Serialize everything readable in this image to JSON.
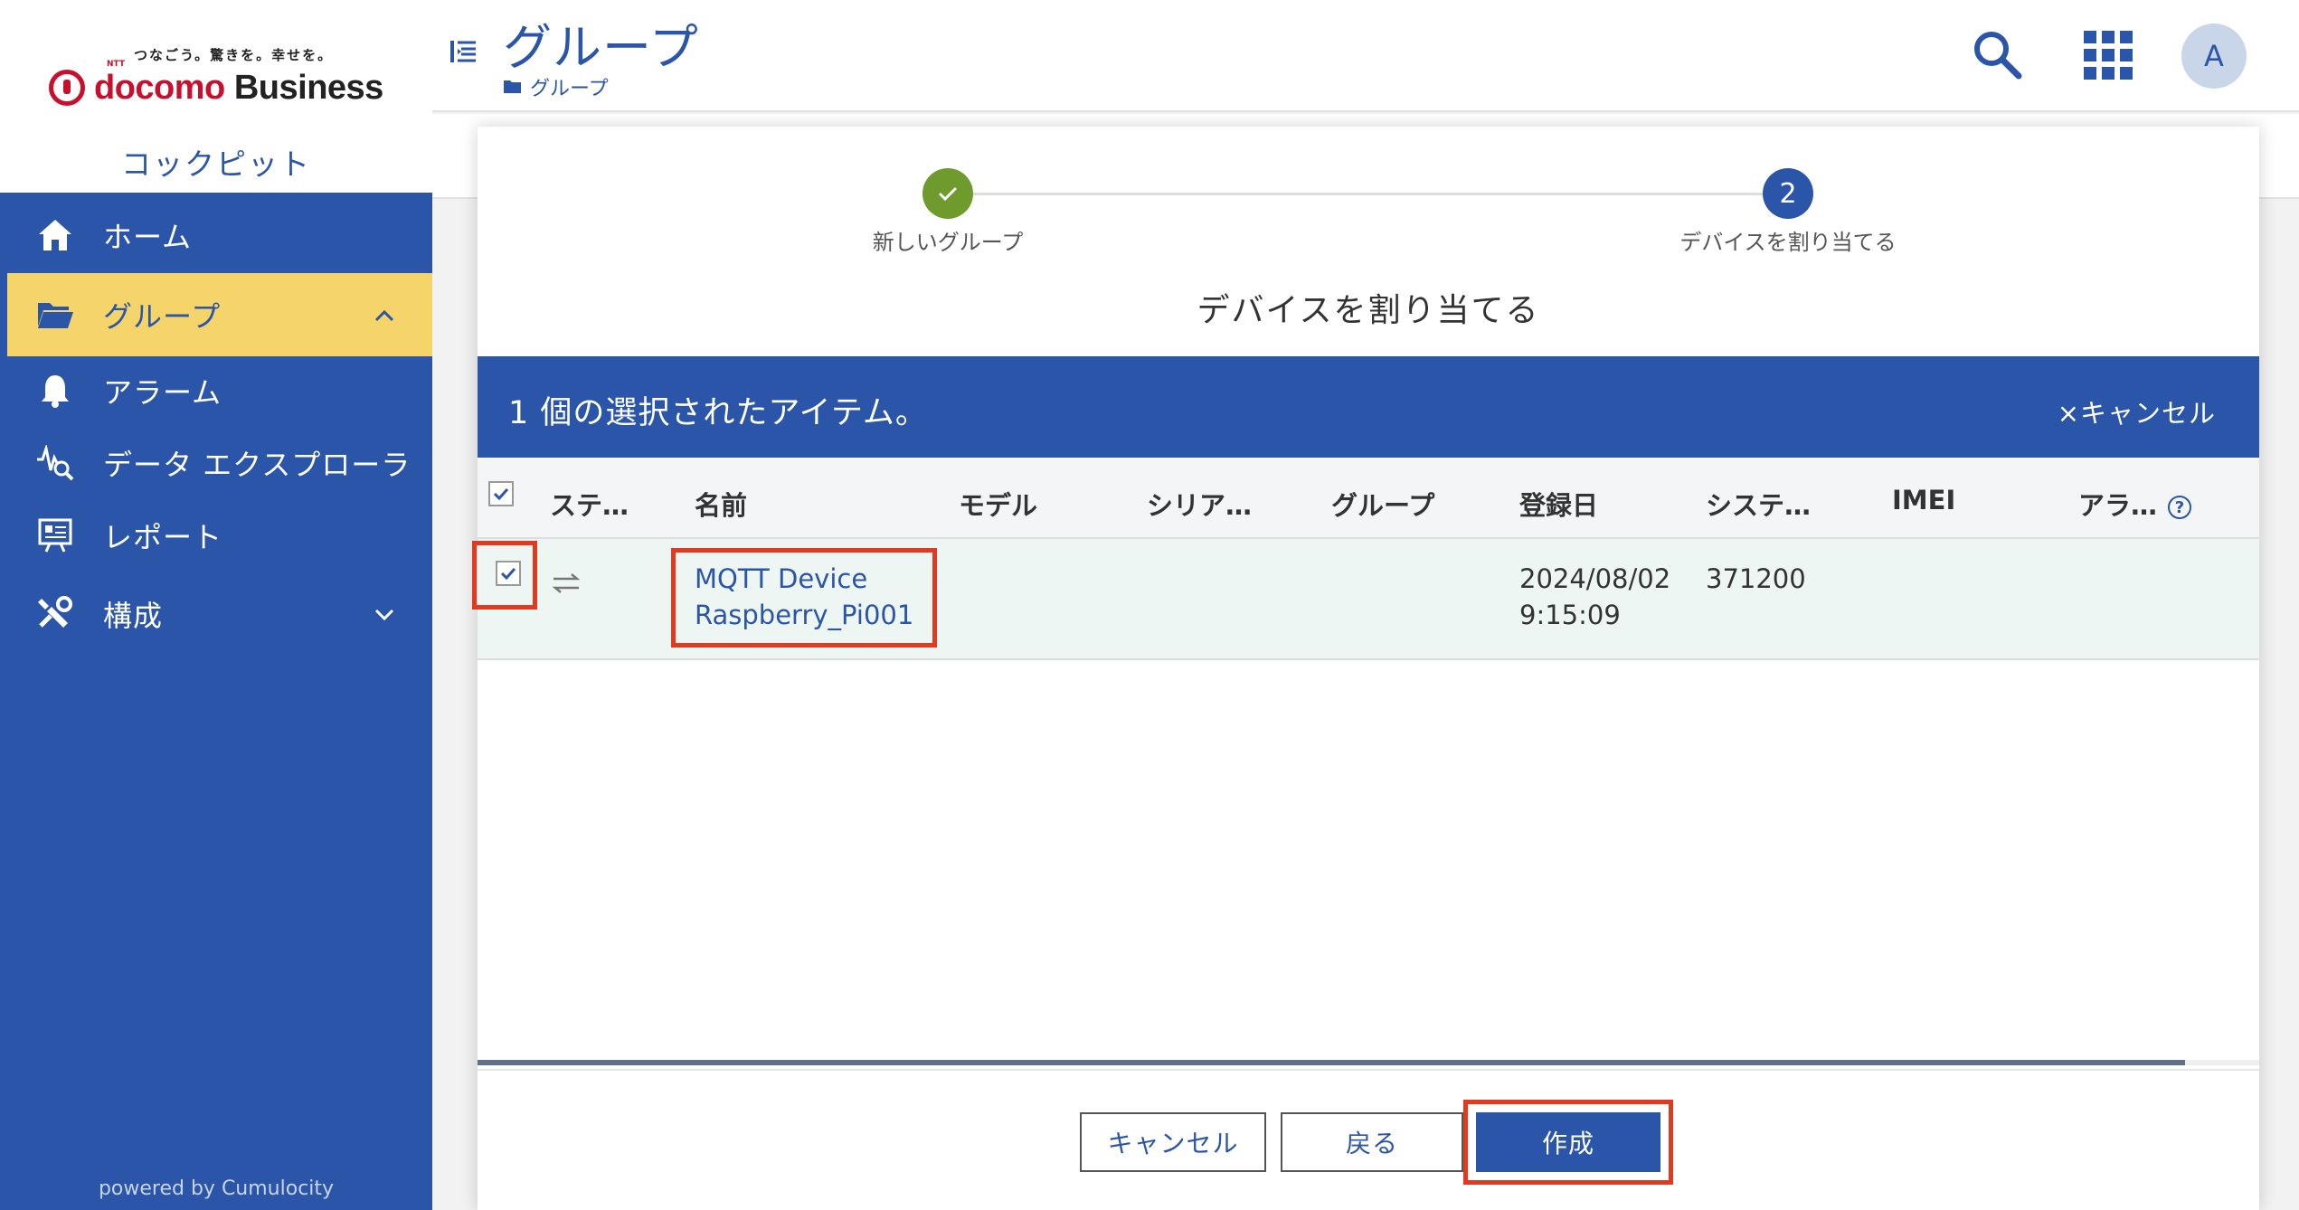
{
  "brand": {
    "tagline": "つなごう。驚きを。幸せを。",
    "ntt": "NTT",
    "logo_docomo": "docomo",
    "logo_business": "Business",
    "app_name": "コックピット",
    "powered_by": "powered by Cumulocity"
  },
  "sidebar": {
    "items": [
      {
        "label": "ホーム",
        "icon": "home-icon"
      },
      {
        "label": "グループ",
        "icon": "folder-icon",
        "active": true
      },
      {
        "label": "アラーム",
        "icon": "bell-icon"
      },
      {
        "label": "データ エクスプローラ",
        "icon": "data-explorer-icon"
      },
      {
        "label": "レポート",
        "icon": "report-icon"
      },
      {
        "label": "構成",
        "icon": "wrench-icon"
      }
    ]
  },
  "header": {
    "title": "グループ",
    "breadcrumb": "グループ",
    "avatar_initial": "A"
  },
  "stepper": {
    "steps": [
      {
        "number": "1",
        "label": "新しいグループ",
        "status": "done"
      },
      {
        "number": "2",
        "label": "デバイスを割り当てる",
        "status": "current"
      }
    ]
  },
  "dialog": {
    "title": "デバイスを割り当てる",
    "selection_text": "1 個の選択されたアイテム。",
    "selection_cancel": "×キャンセル"
  },
  "table": {
    "columns": [
      "ステ…",
      "名前",
      "モデル",
      "シリア…",
      "グループ",
      "登録日",
      "システ…",
      "IMEI",
      "アラ…"
    ],
    "rows": [
      {
        "checked": true,
        "name_line1": "MQTT Device",
        "name_line2": "Raspberry_Pi001",
        "model": "",
        "serial": "",
        "group": "",
        "registered_date": "2024/08/02",
        "registered_time": "9:15:09",
        "system_id": "371200",
        "imei": "",
        "alarms": ""
      }
    ]
  },
  "buttons": {
    "cancel": "キャンセル",
    "back": "戻る",
    "create": "作成"
  },
  "colors": {
    "primary": "#2a55a8",
    "active_nav": "#f5d46a",
    "success": "#6f9a2c",
    "highlight": "#e03a20",
    "brand_red": "#c8102e"
  }
}
